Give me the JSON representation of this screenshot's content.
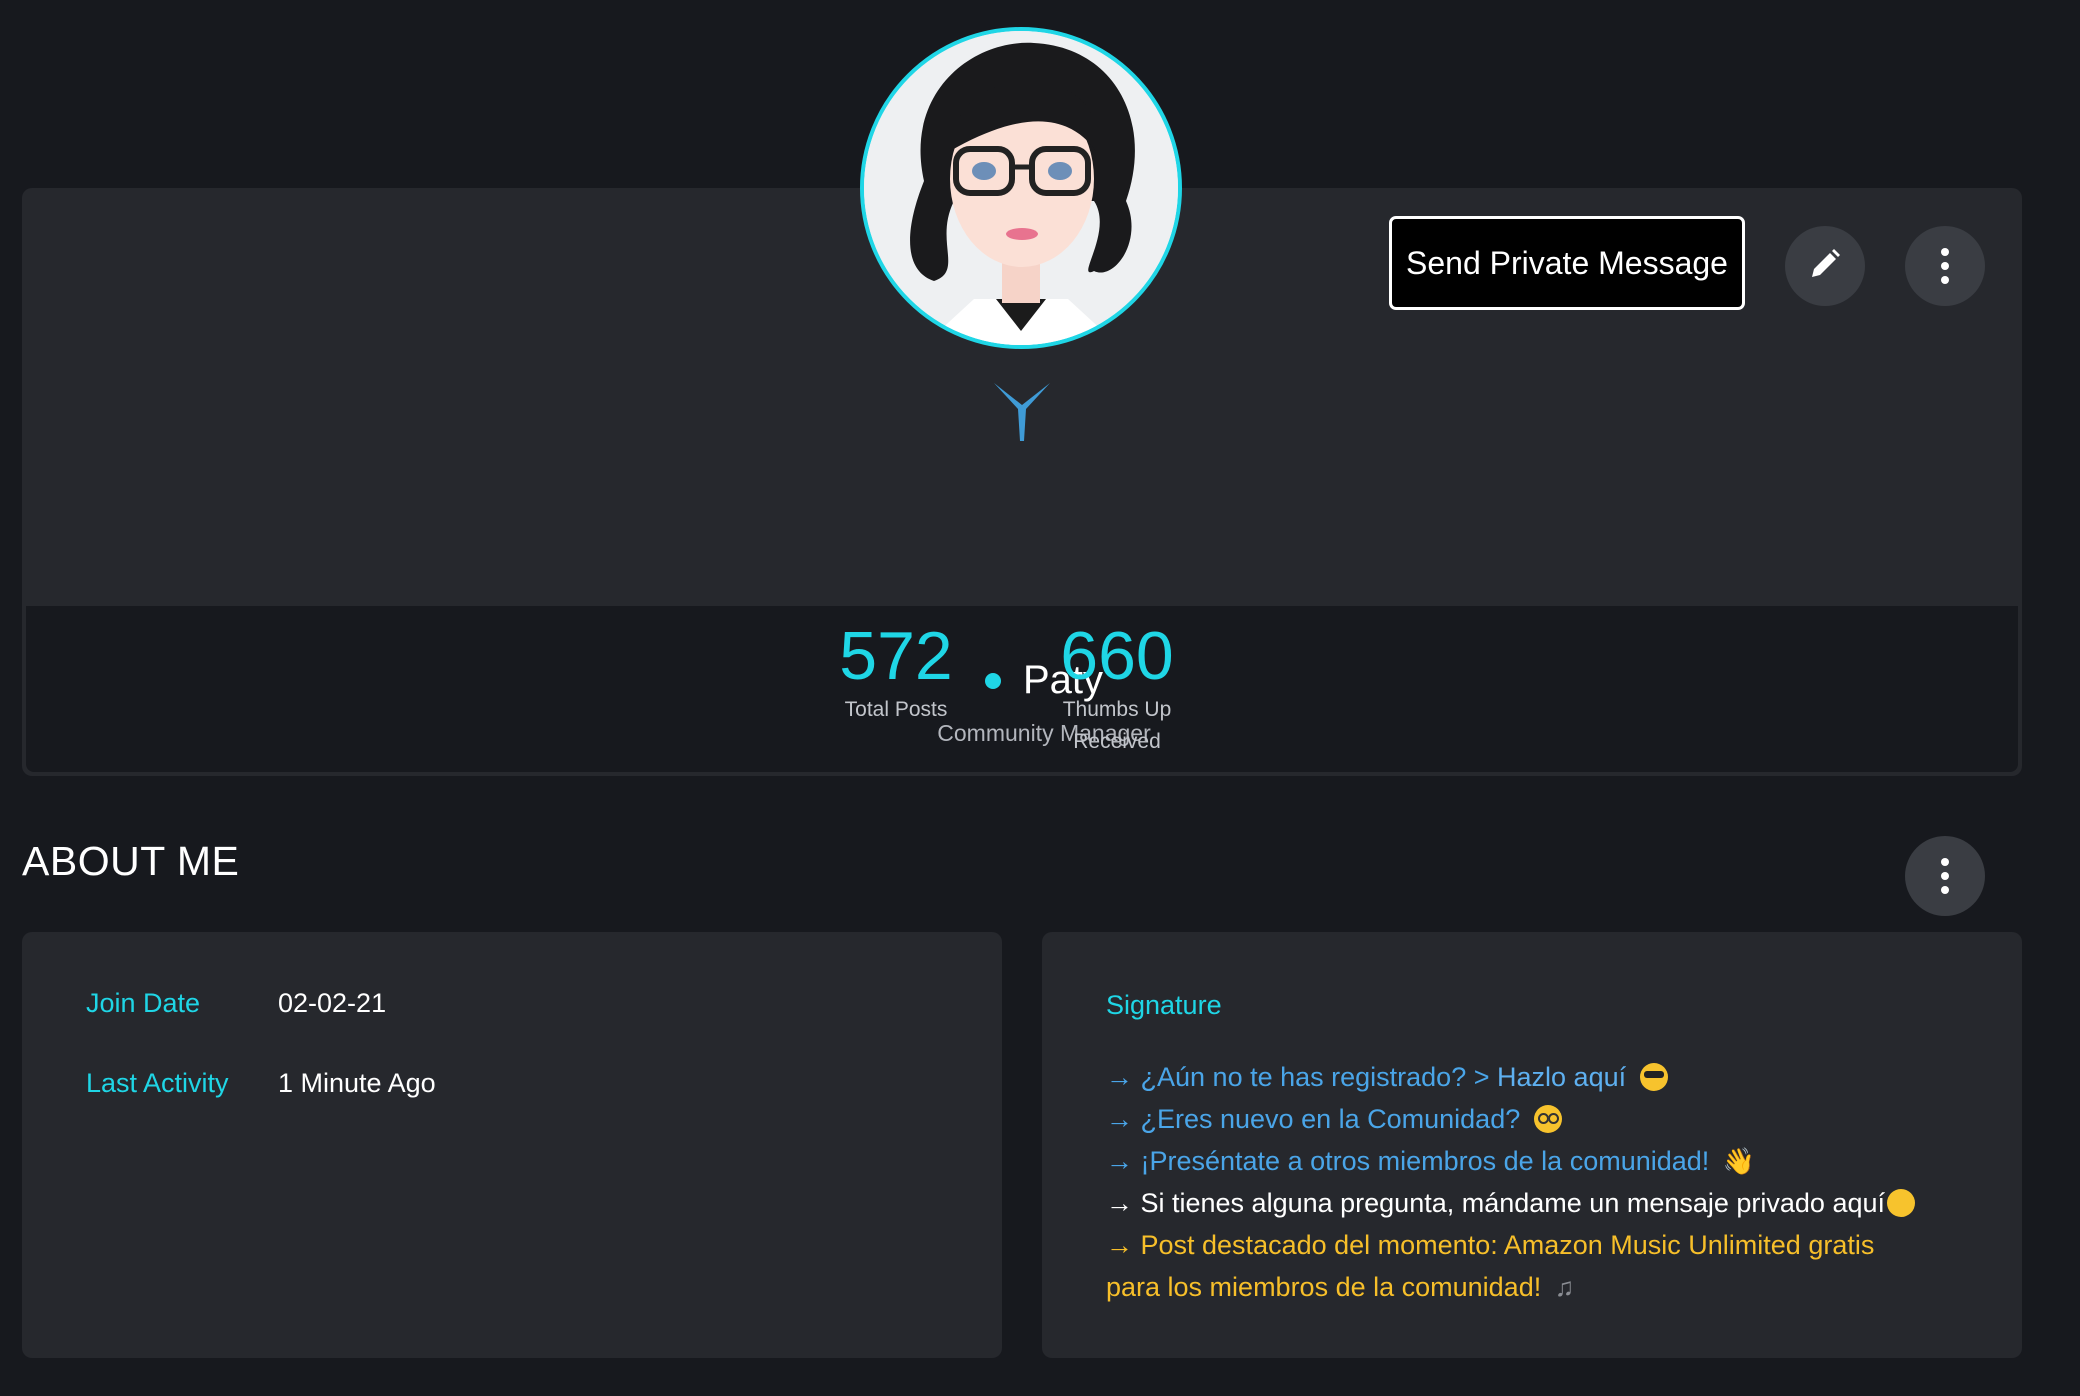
{
  "profile": {
    "name": "Paty",
    "role": "Community Manager",
    "online_status_color": "#1fd6e6",
    "avatar_icon": "avatar-woman-glasses-icon",
    "rank_icon": "rank-chevron-icon"
  },
  "actions": {
    "send_pm_label": "Send Private Message",
    "edit_icon": "pencil-icon",
    "more_icon": "more-vertical-icon"
  },
  "stats": [
    {
      "value": "572",
      "label": "Total Posts"
    },
    {
      "value": "660",
      "label": "Thumbs Up Received",
      "label_line1": "Thumbs Up",
      "label_line2": "Received"
    }
  ],
  "about": {
    "title": "ABOUT ME",
    "join_date_label": "Join Date",
    "join_date_value": "02-02-21",
    "last_activity_label": "Last Activity",
    "last_activity_value": "1 Minute Ago"
  },
  "signature": {
    "title": "Signature",
    "line1_arrow": "→",
    "line1_text": "¿Aún no te has registrado? >",
    "line1_link": "Hazlo aquí",
    "line2_text": "→ ¿Eres nuevo en la Comunidad?",
    "line3_text": "→ ¡Preséntate a otros miembros de la comunidad!",
    "line4_text": "→ Si tienes alguna pregunta, mándame un mensaje privado aquí",
    "line5_text": "→ Post destacado del momento: Amazon Music Unlimited gratis",
    "line6_text": "para los miembros de la comunidad!",
    "emoji_wave": "👋",
    "emoji_note": "♫"
  },
  "colors": {
    "accent": "#1fd6e6",
    "background": "#17191e",
    "card": "#26282d",
    "signature_blue": "#4aa5e8",
    "signature_gold": "#f7bf2a"
  }
}
